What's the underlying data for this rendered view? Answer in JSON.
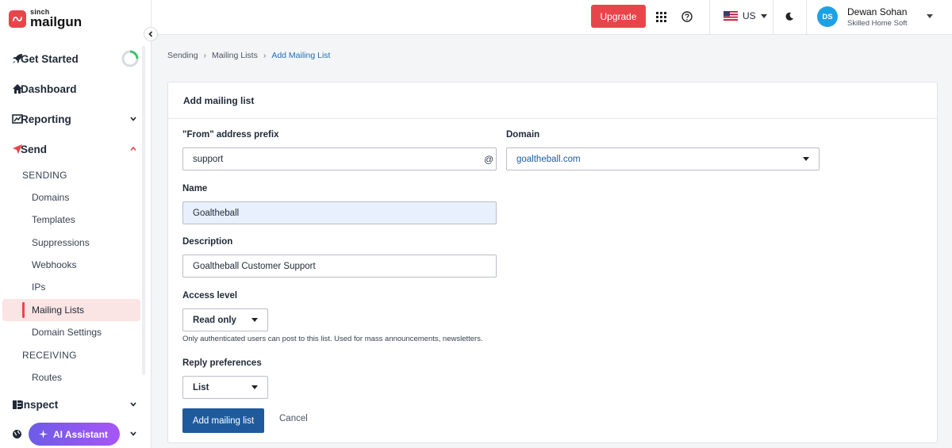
{
  "brand": {
    "small": "sinch",
    "big": "mailgun"
  },
  "sidebar": {
    "top_items": [
      {
        "label": "Get Started",
        "icon": "rocket-icon"
      },
      {
        "label": "Dashboard",
        "icon": "home-icon"
      },
      {
        "label": "Reporting",
        "icon": "chart-icon"
      },
      {
        "label": "Send",
        "icon": "paper-plane-icon"
      }
    ],
    "sending_section": "SENDING",
    "sending_items": [
      "Domains",
      "Templates",
      "Suppressions",
      "Webhooks",
      "IPs",
      "Mailing Lists",
      "Domain Settings"
    ],
    "active_item": "Mailing Lists",
    "receiving_section": "RECEIVING",
    "receiving_items": [
      "Routes"
    ],
    "inspect": "Inspect",
    "ai_assistant": "AI Assistant",
    "get_started_progress": 0.25
  },
  "topbar": {
    "upgrade": "Upgrade",
    "region": "US",
    "user": {
      "initials": "DS",
      "name": "Dewan Sohan",
      "org": "Skilled Home Soft"
    }
  },
  "breadcrumb": [
    "Sending",
    "Mailing Lists",
    "Add Mailing List"
  ],
  "form": {
    "title": "Add mailing list",
    "from_label": "\"From\" address prefix",
    "from_value": "support",
    "at_symbol": "@",
    "domain_label": "Domain",
    "domain_value": "goaltheball.com",
    "name_label": "Name",
    "name_value": "Goaltheball",
    "description_label": "Description",
    "description_value": "Goaltheball Customer Support",
    "access_label": "Access level",
    "access_value": "Read only",
    "access_help": "Only authenticated users can post to this list. Used for mass announcements, newsletters.",
    "reply_label": "Reply preferences",
    "reply_value": "List",
    "submit": "Add mailing list",
    "cancel": "Cancel"
  },
  "colors": {
    "brand_red": "#e8454a",
    "primary_blue": "#1f5a9c",
    "link_blue": "#1f6fb5",
    "active_bg": "#fbe4e4",
    "ai_gradient_start": "#6d5ce7",
    "ai_gradient_end": "#a855f7",
    "avatar_blue": "#1da1e6"
  }
}
